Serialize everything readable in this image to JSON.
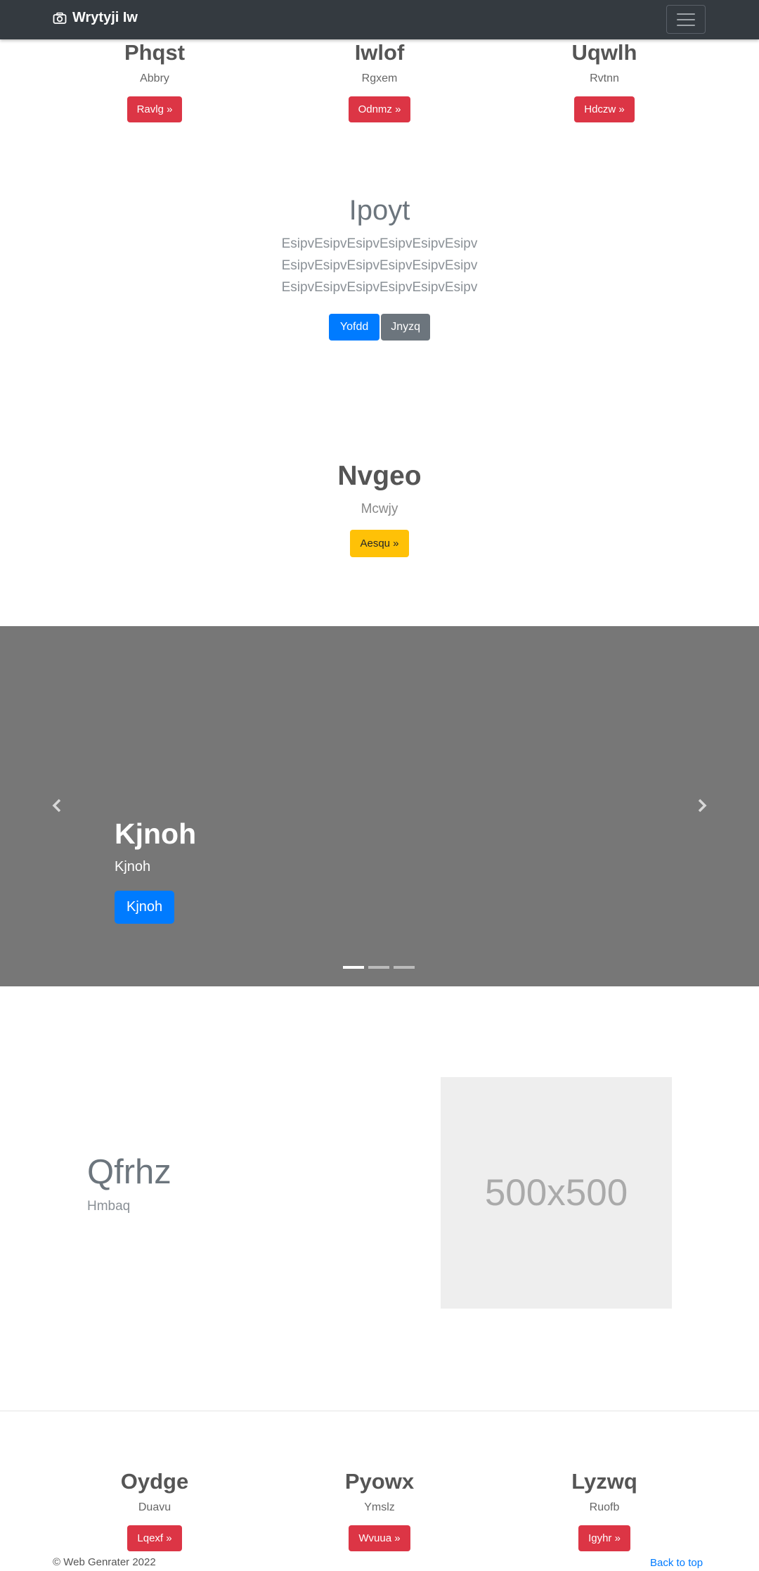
{
  "navbar": {
    "brand": "Wrytyji Iw",
    "brand_icon": "camera-icon",
    "toggler_icon": "hamburger-icon"
  },
  "top_columns": [
    {
      "title": "Phqst",
      "subtitle": "Abbry",
      "button": "Ravlg »"
    },
    {
      "title": "Iwlof",
      "subtitle": "Rgxem",
      "button": "Odnmz »"
    },
    {
      "title": "Uqwlh",
      "subtitle": "Rvtnn",
      "button": "Hdczw »"
    }
  ],
  "jumbotron": {
    "title": "Ipoyt",
    "lead": "EsipvEsipvEsipvEsipvEsipvEsipv EsipvEsipvEsipvEsipvEsipvEsipv EsipvEsipvEsipvEsipvEsipvEsipv",
    "primary_button": "Yofdd",
    "secondary_button": "Jnyzq"
  },
  "feature": {
    "title": "Nvgeo",
    "subtitle": "Mcwjy",
    "button": "Aesqu »"
  },
  "carousel": {
    "heading": "Kjnoh",
    "text": "Kjnoh",
    "button": "Kjnoh",
    "slide_count": 3,
    "active_index": 0
  },
  "featurette": {
    "title": "Qfrhz",
    "subtitle": "Hmbaq",
    "image_label": "500x500"
  },
  "bottom_columns": [
    {
      "title": "Oydge",
      "subtitle": "Duavu",
      "button": "Lqexf »"
    },
    {
      "title": "Pyowx",
      "subtitle": "Ymslz",
      "button": "Wvuua »"
    },
    {
      "title": "Lyzwq",
      "subtitle": "Ruofb",
      "button": "Igyhr »"
    }
  ],
  "footer": {
    "copyright": "© Web Genrater 2022",
    "back_to_top": "Back to top"
  },
  "colors": {
    "navbar": "#343a40",
    "danger": "#dc3545",
    "primary": "#007bff",
    "secondary": "#6c757d",
    "warning": "#ffc107",
    "carousel_bg": "#777777"
  }
}
